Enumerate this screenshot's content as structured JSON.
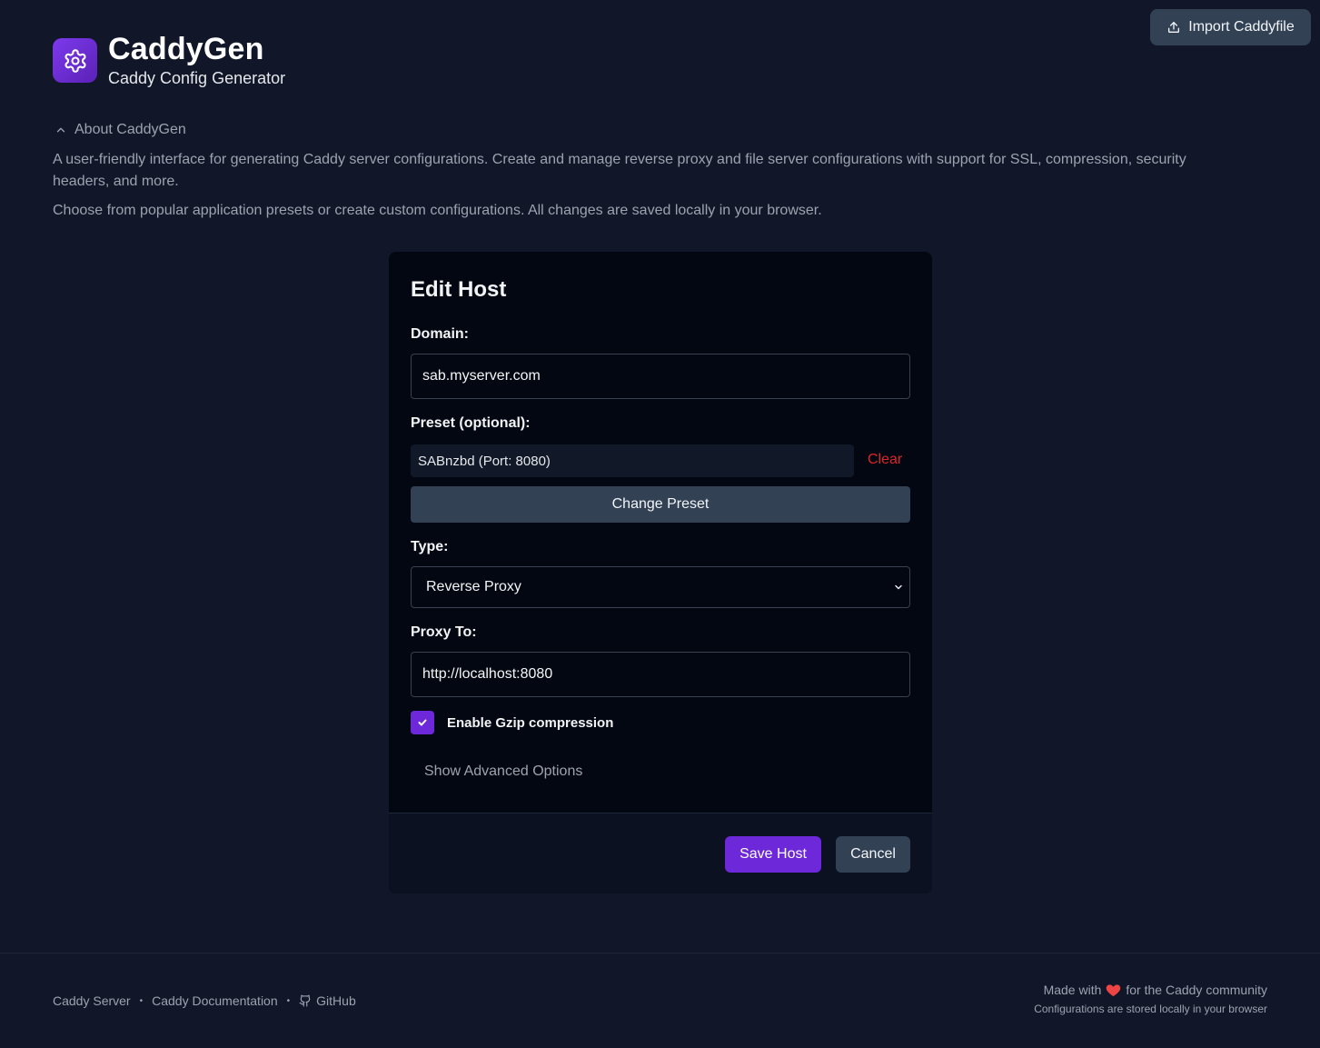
{
  "header": {
    "import_label": "Import Caddyfile",
    "app_title": "CaddyGen",
    "app_subtitle": "Caddy Config Generator"
  },
  "about": {
    "toggle_label": "About CaddyGen",
    "paragraph_1": "A user-friendly interface for generating Caddy server configurations. Create and manage reverse proxy and file server configurations with support for SSL, compression, security headers, and more.",
    "paragraph_2": "Choose from popular application presets or create custom configurations. All changes are saved locally in your browser."
  },
  "form": {
    "title": "Edit Host",
    "domain_label": "Domain:",
    "domain_value": "sab.myserver.com",
    "preset_label": "Preset (optional):",
    "preset_value": "SABnzbd (Port: 8080)",
    "clear_label": "Clear",
    "change_preset_label": "Change Preset",
    "type_label": "Type:",
    "type_value": "Reverse Proxy",
    "proxy_label": "Proxy To:",
    "proxy_value": "http://localhost:8080",
    "gzip_label": "Enable Gzip compression",
    "gzip_checked": true,
    "advanced_label": "Show Advanced Options",
    "save_label": "Save Host",
    "cancel_label": "Cancel"
  },
  "footer": {
    "links": [
      "Caddy Server",
      "Caddy Documentation",
      "GitHub"
    ],
    "made_with_prefix": "Made with",
    "made_with_suffix": "for the Caddy community",
    "storage_note": "Configurations are stored locally in your browser"
  },
  "colors": {
    "background": "#111629",
    "accent": "#6d28d9",
    "danger": "#dc2626",
    "button_secondary": "#334155"
  }
}
